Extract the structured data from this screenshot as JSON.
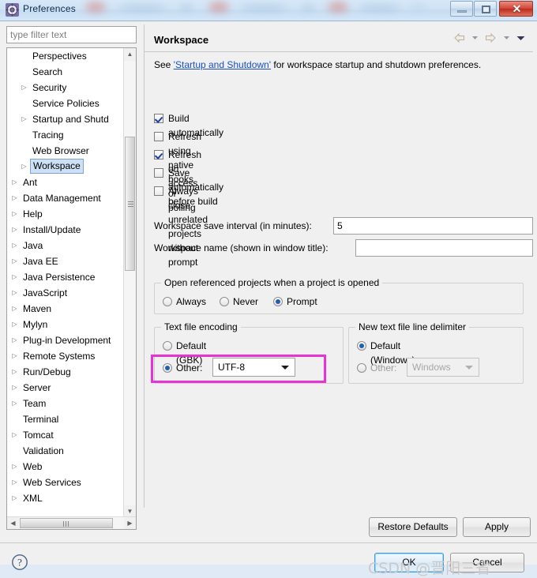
{
  "window": {
    "title": "Preferences",
    "icon": "preferences-gear-icon",
    "buttons": {
      "minimize": "minimize-icon",
      "maximize": "restore-icon",
      "close": "✕"
    }
  },
  "sidebar": {
    "filter_placeholder": "type filter text",
    "filter_value": "",
    "tree": [
      {
        "label": "Perspectives",
        "depth": 1,
        "expandable": false,
        "selected": false
      },
      {
        "label": "Search",
        "depth": 1,
        "expandable": false,
        "selected": false
      },
      {
        "label": "Security",
        "depth": 1,
        "expandable": true,
        "selected": false
      },
      {
        "label": "Service Policies",
        "depth": 1,
        "expandable": false,
        "selected": false
      },
      {
        "label": "Startup and Shutd",
        "depth": 1,
        "expandable": true,
        "selected": false
      },
      {
        "label": "Tracing",
        "depth": 1,
        "expandable": false,
        "selected": false
      },
      {
        "label": "Web Browser",
        "depth": 1,
        "expandable": false,
        "selected": false
      },
      {
        "label": "Workspace",
        "depth": 1,
        "expandable": true,
        "selected": true
      },
      {
        "label": "Ant",
        "depth": 0,
        "expandable": true,
        "selected": false
      },
      {
        "label": "Data Management",
        "depth": 0,
        "expandable": true,
        "selected": false
      },
      {
        "label": "Help",
        "depth": 0,
        "expandable": true,
        "selected": false
      },
      {
        "label": "Install/Update",
        "depth": 0,
        "expandable": true,
        "selected": false
      },
      {
        "label": "Java",
        "depth": 0,
        "expandable": true,
        "selected": false
      },
      {
        "label": "Java EE",
        "depth": 0,
        "expandable": true,
        "selected": false
      },
      {
        "label": "Java Persistence",
        "depth": 0,
        "expandable": true,
        "selected": false
      },
      {
        "label": "JavaScript",
        "depth": 0,
        "expandable": true,
        "selected": false
      },
      {
        "label": "Maven",
        "depth": 0,
        "expandable": true,
        "selected": false
      },
      {
        "label": "Mylyn",
        "depth": 0,
        "expandable": true,
        "selected": false
      },
      {
        "label": "Plug-in Development",
        "depth": 0,
        "expandable": true,
        "selected": false
      },
      {
        "label": "Remote Systems",
        "depth": 0,
        "expandable": true,
        "selected": false
      },
      {
        "label": "Run/Debug",
        "depth": 0,
        "expandable": true,
        "selected": false
      },
      {
        "label": "Server",
        "depth": 0,
        "expandable": true,
        "selected": false
      },
      {
        "label": "Team",
        "depth": 0,
        "expandable": true,
        "selected": false
      },
      {
        "label": "Terminal",
        "depth": 0,
        "expandable": false,
        "selected": false
      },
      {
        "label": "Tomcat",
        "depth": 0,
        "expandable": true,
        "selected": false
      },
      {
        "label": "Validation",
        "depth": 0,
        "expandable": false,
        "selected": false
      },
      {
        "label": "Web",
        "depth": 0,
        "expandable": true,
        "selected": false
      },
      {
        "label": "Web Services",
        "depth": 0,
        "expandable": true,
        "selected": false
      },
      {
        "label": "XML",
        "depth": 0,
        "expandable": true,
        "selected": false
      }
    ]
  },
  "content": {
    "title": "Workspace",
    "nav": {
      "back": "back-arrow-icon",
      "back_menu": "chevron-down-icon",
      "forward": "forward-arrow-icon",
      "forward_menu": "chevron-down-icon",
      "view_menu": "view-menu-icon"
    },
    "intro": {
      "prefix": "See ",
      "link": "'Startup and Shutdown'",
      "suffix": " for workspace startup and shutdown preferences."
    },
    "checkboxes": [
      {
        "label": "Build automatically",
        "checked": true
      },
      {
        "label": "Refresh using native hooks or polling",
        "checked": false
      },
      {
        "label": "Refresh on access",
        "checked": true
      },
      {
        "label": "Save automatically before build",
        "checked": false
      },
      {
        "label": "Always close unrelated projects without prompt",
        "checked": false
      }
    ],
    "fields": [
      {
        "label": "Workspace save interval (in minutes):",
        "value": "5",
        "placeholder": ""
      },
      {
        "label": "Workspace name (shown in window title):",
        "value": "",
        "placeholder": ""
      }
    ],
    "referenced_projects": {
      "title": "Open referenced projects when a project is opened",
      "options": [
        {
          "label": "Always",
          "selected": false
        },
        {
          "label": "Never",
          "selected": false
        },
        {
          "label": "Prompt",
          "selected": true
        }
      ]
    },
    "text_file_encoding": {
      "title": "Text file encoding",
      "default_label": "Default (GBK)",
      "default_selected": false,
      "other_label": "Other:",
      "other_selected": true,
      "other_value": "UTF-8",
      "highlight_color": "#e832d6"
    },
    "line_delimiter": {
      "title": "New text file line delimiter",
      "default_label": "Default (Windows)",
      "default_selected": true,
      "other_label": "Other:",
      "other_selected": false,
      "other_value": "Windows",
      "other_disabled": true
    },
    "buttons": {
      "restore_defaults": "Restore Defaults",
      "apply": "Apply"
    }
  },
  "footer": {
    "help": "?",
    "ok": "OK",
    "cancel": "Cancel"
  },
  "watermark": "CSDN @晋阳三省"
}
